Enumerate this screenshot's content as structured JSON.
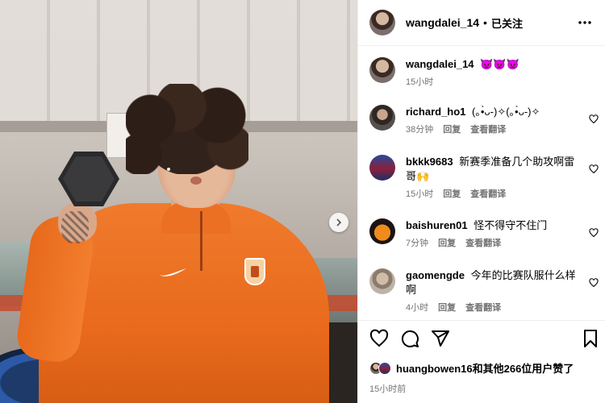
{
  "post": {
    "author": "wangdalei_14",
    "follow_status": "已关注",
    "dot": "•",
    "caption_text": "👿👿👿",
    "caption_time": "15小时"
  },
  "icons": {
    "more": "more-options-icon",
    "next": "chevron-right-icon",
    "like": "heart-icon",
    "comment": "comment-icon",
    "share": "send-icon",
    "save": "bookmark-icon"
  },
  "comments": [
    {
      "user": "richard_ho1",
      "text": "(｡•̀ᴗ-)✧(｡•̀ᴗ-)✧",
      "time": "38分钟",
      "reply": "回复",
      "translate": "查看翻译"
    },
    {
      "user": "bkkk9683",
      "text": "新赛季准备几个助攻啊雷哥🙌",
      "time": "15小时",
      "reply": "回复",
      "translate": "查看翻译"
    },
    {
      "user": "baishuren01",
      "text": "怪不得守不住门",
      "time": "7分钟",
      "reply": "回复",
      "translate": "查看翻译"
    },
    {
      "user": "gaomengde",
      "text": "今年的比赛队服什么样啊",
      "time": "4小时",
      "reply": "回复",
      "translate": "查看翻译"
    }
  ],
  "likes": {
    "text": "huangbowen16和其他266位用户赞了"
  },
  "timeago": "15小时前",
  "colors": {
    "accent": "#e96a1c",
    "muted": "#737373",
    "divider": "#efefef"
  }
}
